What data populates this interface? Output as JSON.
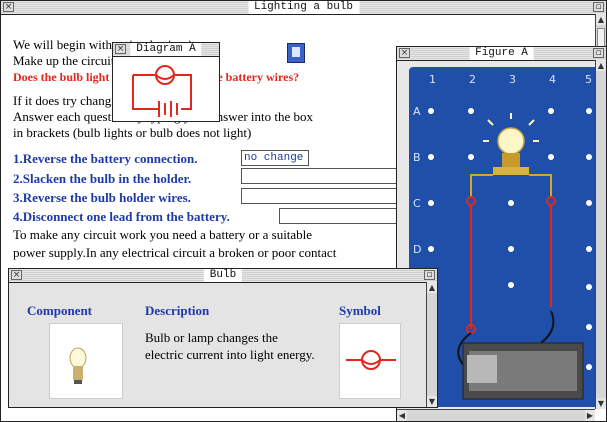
{
  "main": {
    "title": "Lighting a bulb",
    "lines": [
      "We will begin with a simple circuit.",
      "Make up the circuit in Diagram A.",
      "If it does try changing the circuit.",
      "Answer each question by typing your answer into the box",
      "in brackets (bulb lights or bulb does not light)",
      "To make any circuit work you need a battery or a suitable",
      "power supply.In any electrical circuit a broken or poor contact"
    ],
    "red_question": "Does the bulb light when you connect the battery wires?",
    "questions": [
      {
        "label": "1.Reverse the battery connection.",
        "answer": "no change"
      },
      {
        "label": "2.Slacken the bulb in the holder.",
        "answer": ""
      },
      {
        "label": "3.Reverse the bulb holder wires.",
        "answer": ""
      },
      {
        "label": "4.Disconnect one lead from the battery.",
        "answer": ""
      }
    ]
  },
  "diagram": {
    "title": "Diagram A"
  },
  "figure": {
    "title": "Figure A",
    "columns": [
      "1",
      "2",
      "3",
      "4",
      "5"
    ],
    "rows": [
      "A",
      "B",
      "C",
      "D"
    ]
  },
  "bulb_window": {
    "title": "Bulb",
    "headers": {
      "component": "Component",
      "description": "Description",
      "symbol": "Symbol"
    },
    "description": "Bulb or lamp changes the electric current into light energy."
  },
  "colors": {
    "link_blue": "#1e3aa8",
    "red_text": "#e0291c",
    "board_blue": "#1f4fa8"
  }
}
